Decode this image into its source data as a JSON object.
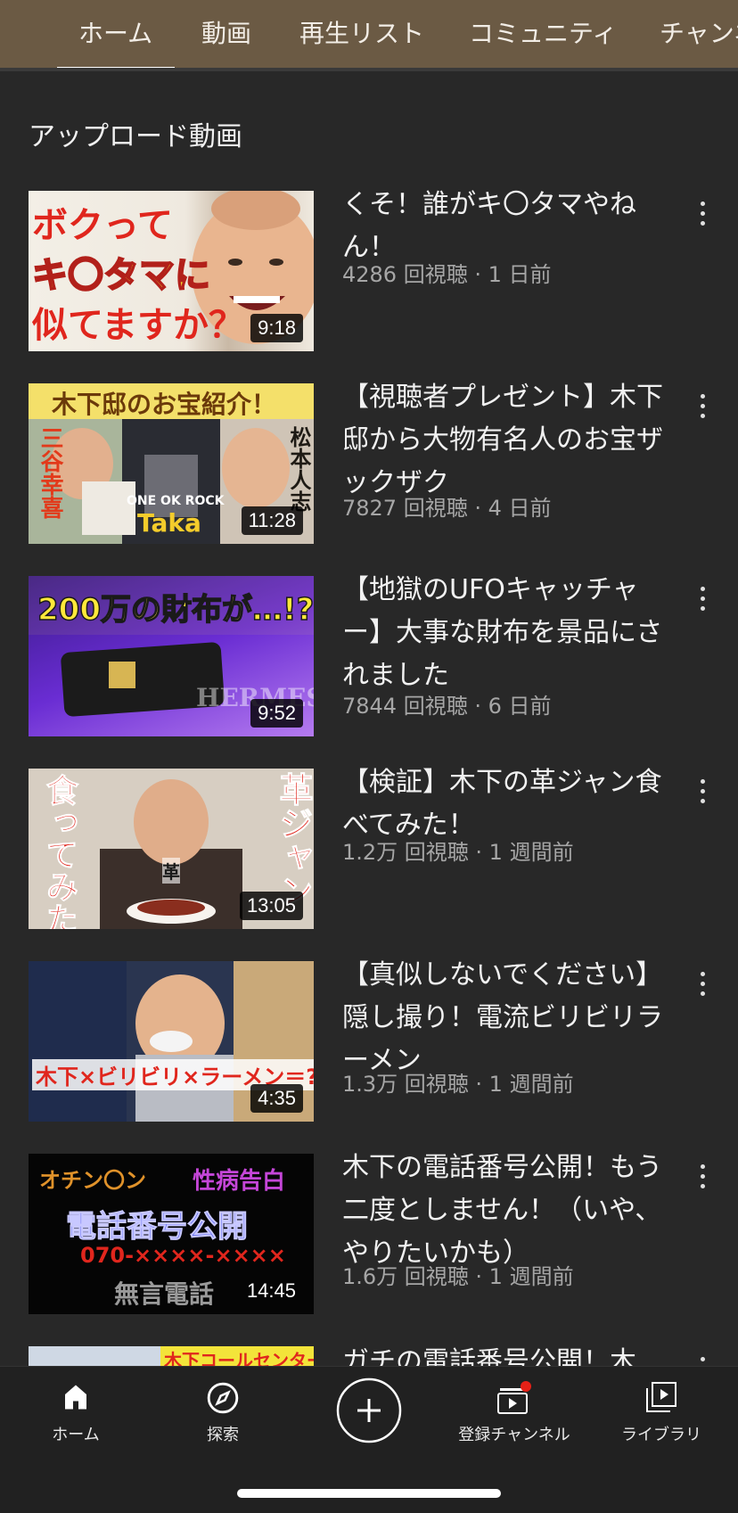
{
  "tabs": [
    {
      "label": "ホーム",
      "selected": true
    },
    {
      "label": "動画"
    },
    {
      "label": "再生リスト"
    },
    {
      "label": "コミュニティ"
    },
    {
      "label": "チャンネ"
    }
  ],
  "section_title": "アップロード動画",
  "videos": [
    {
      "title": "くそ！誰がキ〇タマやねん！",
      "meta": "4286 回視聴 · 1 日前",
      "duration": "9:18",
      "thumb_text": [
        "ボクって",
        "キ〇タマに",
        "似てますか？"
      ]
    },
    {
      "title": "【視聴者プレゼント】木下邸から大物有名人のお宝ザックザク",
      "meta": "7827 回視聴 · 4 日前",
      "duration": "11:28",
      "thumb_text": [
        "木下邸のお宝紹介！",
        "三谷幸喜",
        "ONE OK ROCK",
        "Taka",
        "松本人志"
      ]
    },
    {
      "title": "【地獄のUFOキャッチャー】大事な財布を景品にされました",
      "meta": "7844 回視聴 · 6 日前",
      "duration": "9:52",
      "thumb_text": [
        "200万の財布が…!?",
        "HERMES"
      ]
    },
    {
      "title": "【検証】木下の革ジャン食べてみた！",
      "meta": "1.2万 回視聴 · 1 週間前",
      "duration": "13:05",
      "thumb_text": [
        "食ってみた",
        "革ジャン",
        "革"
      ]
    },
    {
      "title": "【真似しないでください】隠し撮り！電流ビリビリラーメン",
      "meta": "1.3万 回視聴 · 1 週間前",
      "duration": "4:35",
      "thumb_text": [
        "木下×ビリビリ×ラーメン＝?"
      ]
    },
    {
      "title": "木下の電話番号公開！もう二度としません！（いや、やりたいかも）",
      "meta": "1.6万 回視聴 · 1 週間前",
      "duration": "14:45",
      "thumb_text": [
        "オチン〇ン",
        "性病告白",
        "電話番号公開",
        "070-××××-××××",
        "無言電話"
      ]
    },
    {
      "title": "ガチの電話番号公開！木",
      "meta": "",
      "duration": "",
      "thumb_text": [
        "木下コールセンター"
      ]
    }
  ],
  "bottom_nav": [
    {
      "label": "ホーム",
      "icon": "home-icon"
    },
    {
      "label": "探索",
      "icon": "compass-icon"
    },
    {
      "label": "",
      "icon": "create-plus-icon"
    },
    {
      "label": "登録チャンネル",
      "icon": "subscriptions-icon"
    },
    {
      "label": "ライブラリ",
      "icon": "library-icon"
    }
  ],
  "colors": {
    "header": "#6b5a44",
    "background": "#282828",
    "notification": "#e62117"
  }
}
